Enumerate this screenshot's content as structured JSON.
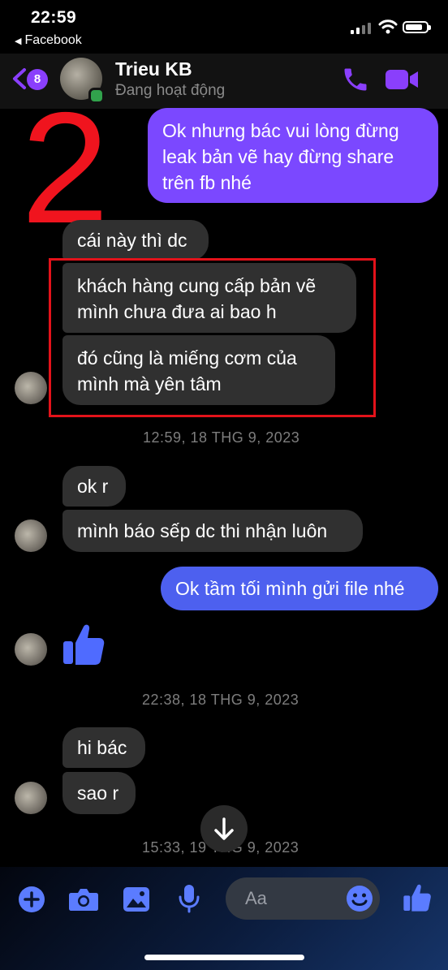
{
  "status_bar": {
    "time": "22:59",
    "back_app": "Facebook"
  },
  "header": {
    "unread_count": "8",
    "contact_name": "Trieu KB",
    "contact_status": "Đang hoạt động"
  },
  "annotation": {
    "number": "2"
  },
  "messages": {
    "m1": "Ok nhưng bác vui lòng đừng leak bản vẽ hay đừng share trên fb nhé",
    "m2": "cái này thì dc",
    "m3": "khách hàng cung cấp bản vẽ mình chưa đưa ai bao h",
    "m4": "đó cũng là miếng cơm của mình mà yên tâm",
    "ts1": "12:59, 18 THG 9, 2023",
    "m5": "ok r",
    "m6": "mình báo sếp dc thi nhận luôn",
    "m7": "Ok tầm tối mình gửi file nhé",
    "ts2": "22:38, 18 THG 9, 2023",
    "m8": "hi bác",
    "m9": "sao r",
    "ts3": "15:33, 19 THG 9, 2023"
  },
  "composer": {
    "placeholder": "Aa"
  },
  "colors": {
    "accent": "#8a3ffc",
    "outgoing_bubble": "#7b48ff",
    "incoming_bubble": "#303030",
    "annotation_red": "#e3121a",
    "online": "#31a24c"
  },
  "icons": {
    "status": [
      "signal-icon",
      "wifi-icon",
      "battery-icon"
    ],
    "header": [
      "back-chevron-icon",
      "phone-icon",
      "video-camera-icon"
    ],
    "composer": [
      "plus-icon",
      "camera-icon",
      "image-icon",
      "microphone-icon",
      "emoji-icon",
      "thumbs-up-icon"
    ]
  }
}
